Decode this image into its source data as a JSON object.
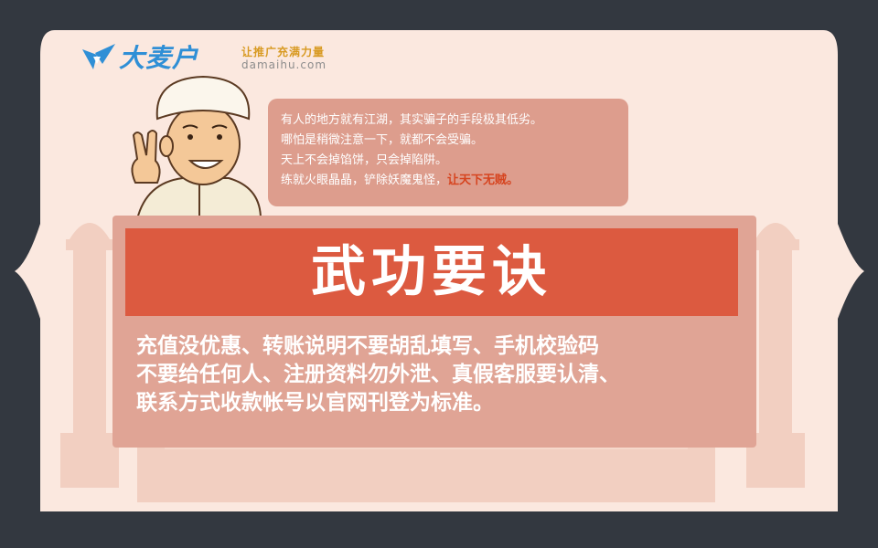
{
  "brand": {
    "name": "大麦户",
    "slogan": "让推广充满力量",
    "domain": "damaihu.com"
  },
  "bubble": {
    "lines": [
      "有人的地方就有江湖，其实骗子的手段极其低劣。",
      "哪怕是稍微注意一下，就都不会受骗。",
      "天上不会掉馅饼，只会掉陷阱。"
    ],
    "last_line_prefix": "练就火眼晶晶，铲除妖魔鬼怪，",
    "last_line_highlight": "让天下无贼。"
  },
  "panel": {
    "title": "武功要诀",
    "lines": [
      "充值没优惠、转账说明不要胡乱填写、手机校验码",
      "不要给任何人、注册资料勿外泄、真假客服要认清、",
      "联系方式收款帐号以官网刊登为标准。"
    ]
  },
  "colors": {
    "background": "#333840",
    "card": "#fbe8df",
    "title_bar": "#dc5a40",
    "panel": "#e0a495",
    "highlight": "#d6441f",
    "brand_blue": "#2f8fd6"
  }
}
